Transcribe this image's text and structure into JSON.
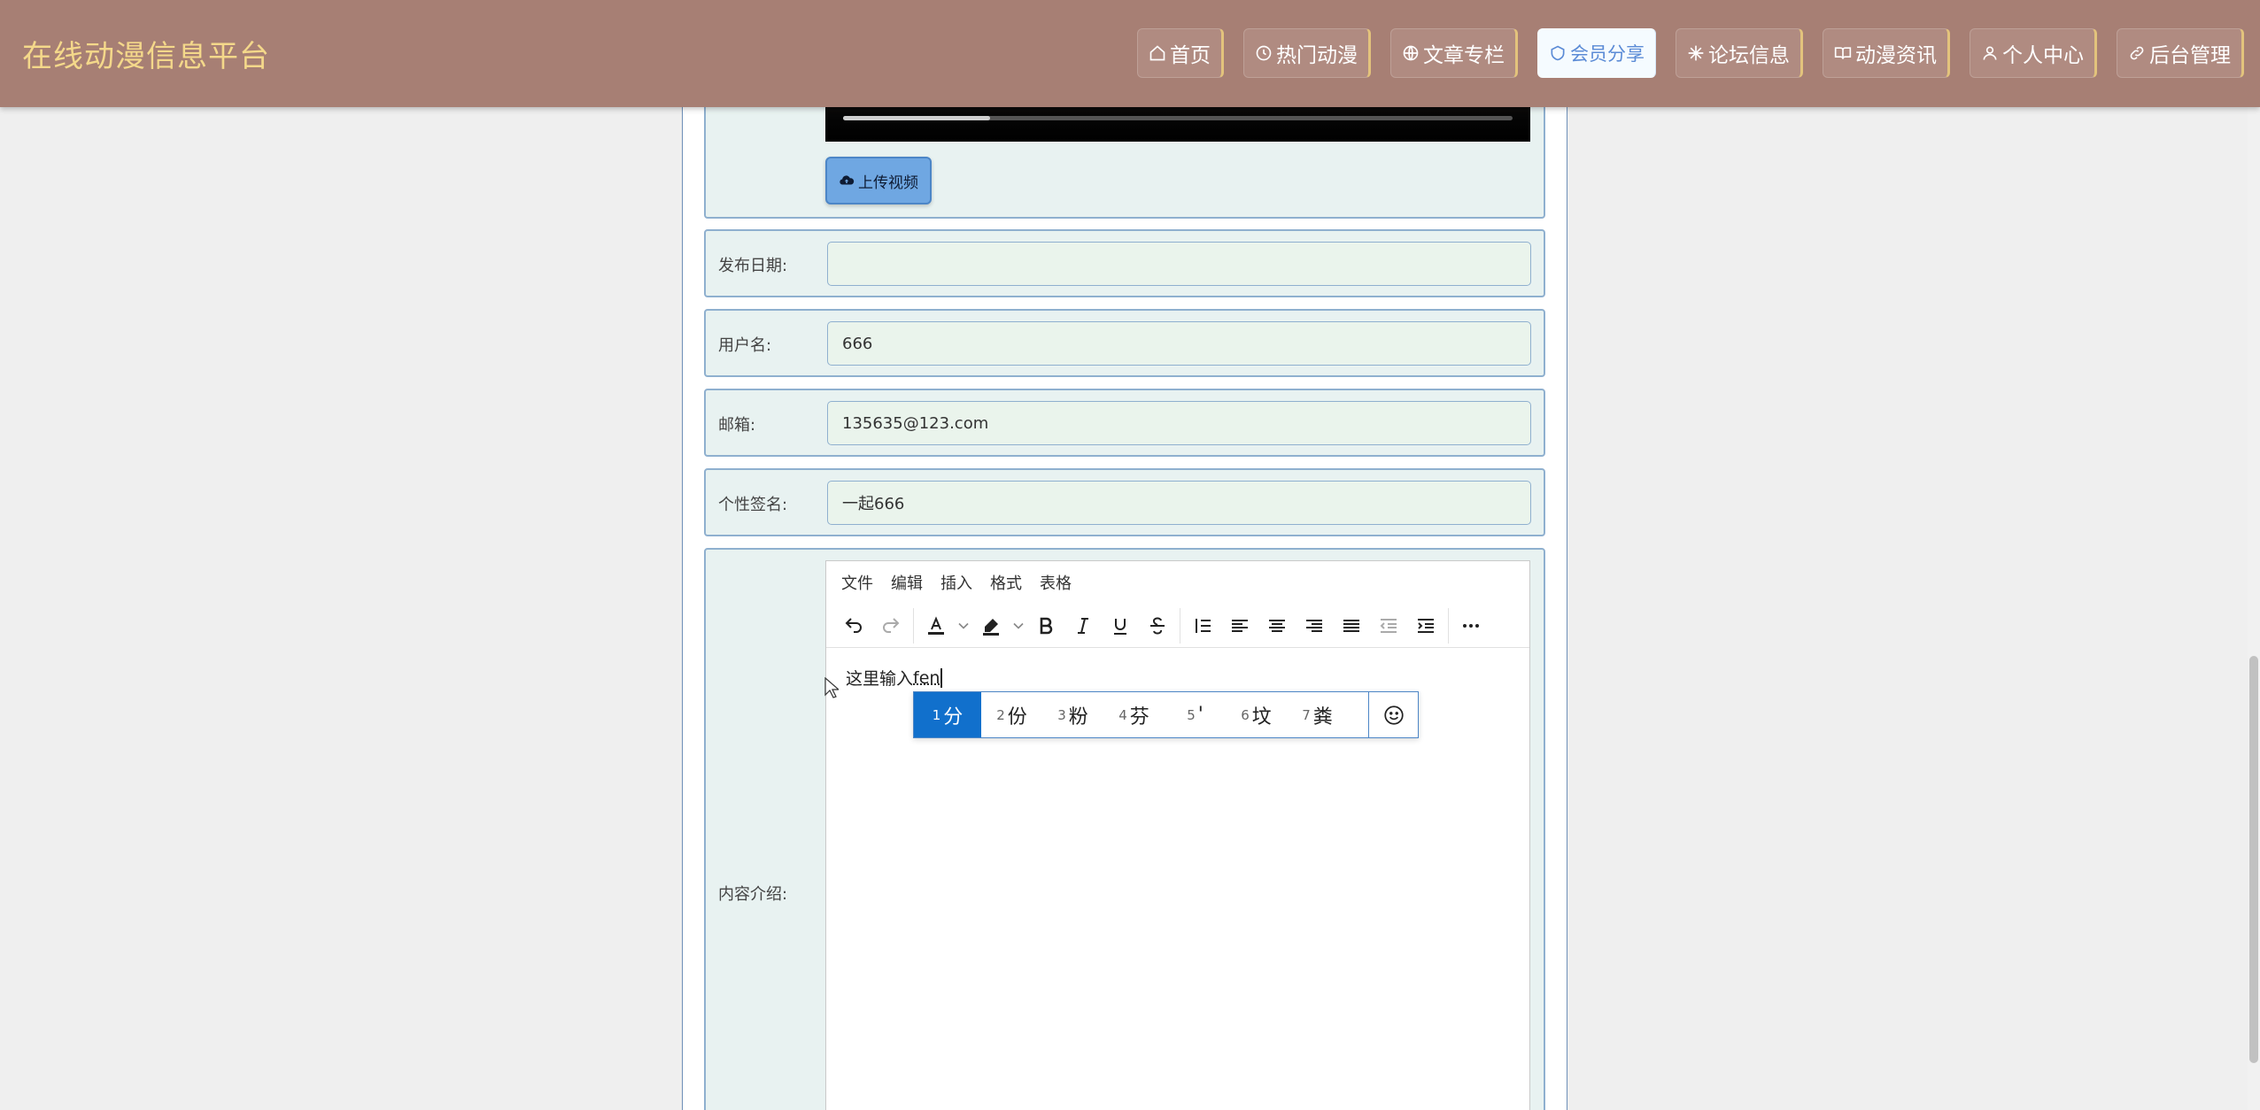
{
  "header": {
    "title": "在线动漫信息平台",
    "nav": [
      {
        "label": "首页",
        "icon": "home-icon",
        "active": false
      },
      {
        "label": "热门动漫",
        "icon": "clock-icon",
        "active": false
      },
      {
        "label": "文章专栏",
        "icon": "globe-icon",
        "active": false
      },
      {
        "label": "会员分享",
        "icon": "shield-icon",
        "active": true
      },
      {
        "label": "论坛信息",
        "icon": "snowflake-icon",
        "active": false
      },
      {
        "label": "动漫资讯",
        "icon": "book-open-icon",
        "active": false
      },
      {
        "label": "个人中心",
        "icon": "user-icon",
        "active": false
      },
      {
        "label": "后台管理",
        "icon": "link-icon",
        "active": false
      }
    ]
  },
  "video": {
    "progress": 0.22
  },
  "upload": {
    "label": "上传视频",
    "icon": "cloud-upload-icon"
  },
  "form": {
    "publish_date": {
      "label": "发布日期:",
      "value": ""
    },
    "username": {
      "label": "用户名:",
      "value": "666"
    },
    "email": {
      "label": "邮箱:",
      "value": "135635@123.com"
    },
    "signature": {
      "label": "个性签名:",
      "value": "一起666"
    },
    "content": {
      "label": "内容介绍:"
    }
  },
  "editor": {
    "menus": [
      "文件",
      "编辑",
      "插入",
      "格式",
      "表格"
    ],
    "toolbar": [
      "undo-icon",
      "redo-icon",
      "text-color-icon",
      "highlight-icon",
      "bold-icon",
      "italic-icon",
      "underline-icon",
      "strikethrough-icon",
      "line-height-icon",
      "align-left-icon",
      "align-center-icon",
      "align-right-icon",
      "align-justify-icon",
      "outdent-icon",
      "indent-icon",
      "more-icon"
    ],
    "text": "这里输入",
    "composing": "fen"
  },
  "ime": {
    "candidates": [
      {
        "num": "1",
        "text": "分"
      },
      {
        "num": "2",
        "text": "份"
      },
      {
        "num": "3",
        "text": "粉"
      },
      {
        "num": "4",
        "text": "芬"
      },
      {
        "num": "5",
        "text": "'"
      },
      {
        "num": "6",
        "text": "坟"
      },
      {
        "num": "7",
        "text": "粪"
      }
    ],
    "selected_index": 0,
    "emoji_icon": "smiley-icon"
  },
  "colors": {
    "header_bg": "#a77f74",
    "brand": "#f4d88a",
    "row_bg": "#e8f2f1",
    "ime_selected": "#1170cc"
  }
}
